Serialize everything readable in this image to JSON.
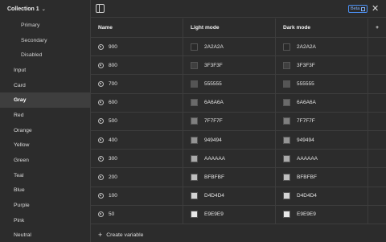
{
  "sidebar": {
    "collection_title": "Collection 1",
    "items": [
      {
        "label": "Primary",
        "sub": true,
        "active": false
      },
      {
        "label": "Secondary",
        "sub": true,
        "active": false
      },
      {
        "label": "Disabled",
        "sub": true,
        "active": false
      },
      {
        "label": "Input",
        "sub": false,
        "active": false
      },
      {
        "label": "Card",
        "sub": false,
        "active": false
      },
      {
        "label": "Gray",
        "sub": false,
        "active": true
      },
      {
        "label": "Red",
        "sub": false,
        "active": false
      },
      {
        "label": "Orange",
        "sub": false,
        "active": false
      },
      {
        "label": "Yellow",
        "sub": false,
        "active": false
      },
      {
        "label": "Green",
        "sub": false,
        "active": false
      },
      {
        "label": "Teal",
        "sub": false,
        "active": false
      },
      {
        "label": "Blue",
        "sub": false,
        "active": false
      },
      {
        "label": "Purple",
        "sub": false,
        "active": false
      },
      {
        "label": "Pink",
        "sub": false,
        "active": false
      },
      {
        "label": "Neutral",
        "sub": false,
        "active": false
      }
    ]
  },
  "topbar": {
    "beta_label": "Beta"
  },
  "table": {
    "headers": {
      "name": "Name",
      "light": "Light mode",
      "dark": "Dark mode",
      "add": "+"
    },
    "rows": [
      {
        "name": "900",
        "light": "2A2A2A",
        "light_color": "#2A2A2A",
        "dark": "2A2A2A",
        "dark_color": "#2A2A2A"
      },
      {
        "name": "800",
        "light": "3F3F3F",
        "light_color": "#3F3F3F",
        "dark": "3F3F3F",
        "dark_color": "#3F3F3F"
      },
      {
        "name": "700",
        "light": "555555",
        "light_color": "#555555",
        "dark": "555555",
        "dark_color": "#555555"
      },
      {
        "name": "600",
        "light": "6A6A6A",
        "light_color": "#6A6A6A",
        "dark": "6A6A6A",
        "dark_color": "#6A6A6A"
      },
      {
        "name": "500",
        "light": "7F7F7F",
        "light_color": "#7F7F7F",
        "dark": "7F7F7F",
        "dark_color": "#7F7F7F"
      },
      {
        "name": "400",
        "light": "949494",
        "light_color": "#949494",
        "dark": "949494",
        "dark_color": "#949494"
      },
      {
        "name": "300",
        "light": "AAAAAA",
        "light_color": "#AAAAAA",
        "dark": "AAAAAA",
        "dark_color": "#AAAAAA"
      },
      {
        "name": "200",
        "light": "BFBFBF",
        "light_color": "#BFBFBF",
        "dark": "BFBFBF",
        "dark_color": "#BFBFBF"
      },
      {
        "name": "100",
        "light": "D4D4D4",
        "light_color": "#D4D4D4",
        "dark": "D4D4D4",
        "dark_color": "#D4D4D4"
      },
      {
        "name": "50",
        "light": "E9E9E9",
        "light_color": "#E9E9E9",
        "dark": "E9E9E9",
        "dark_color": "#E9E9E9"
      }
    ]
  },
  "footer": {
    "create_label": "Create variable"
  }
}
